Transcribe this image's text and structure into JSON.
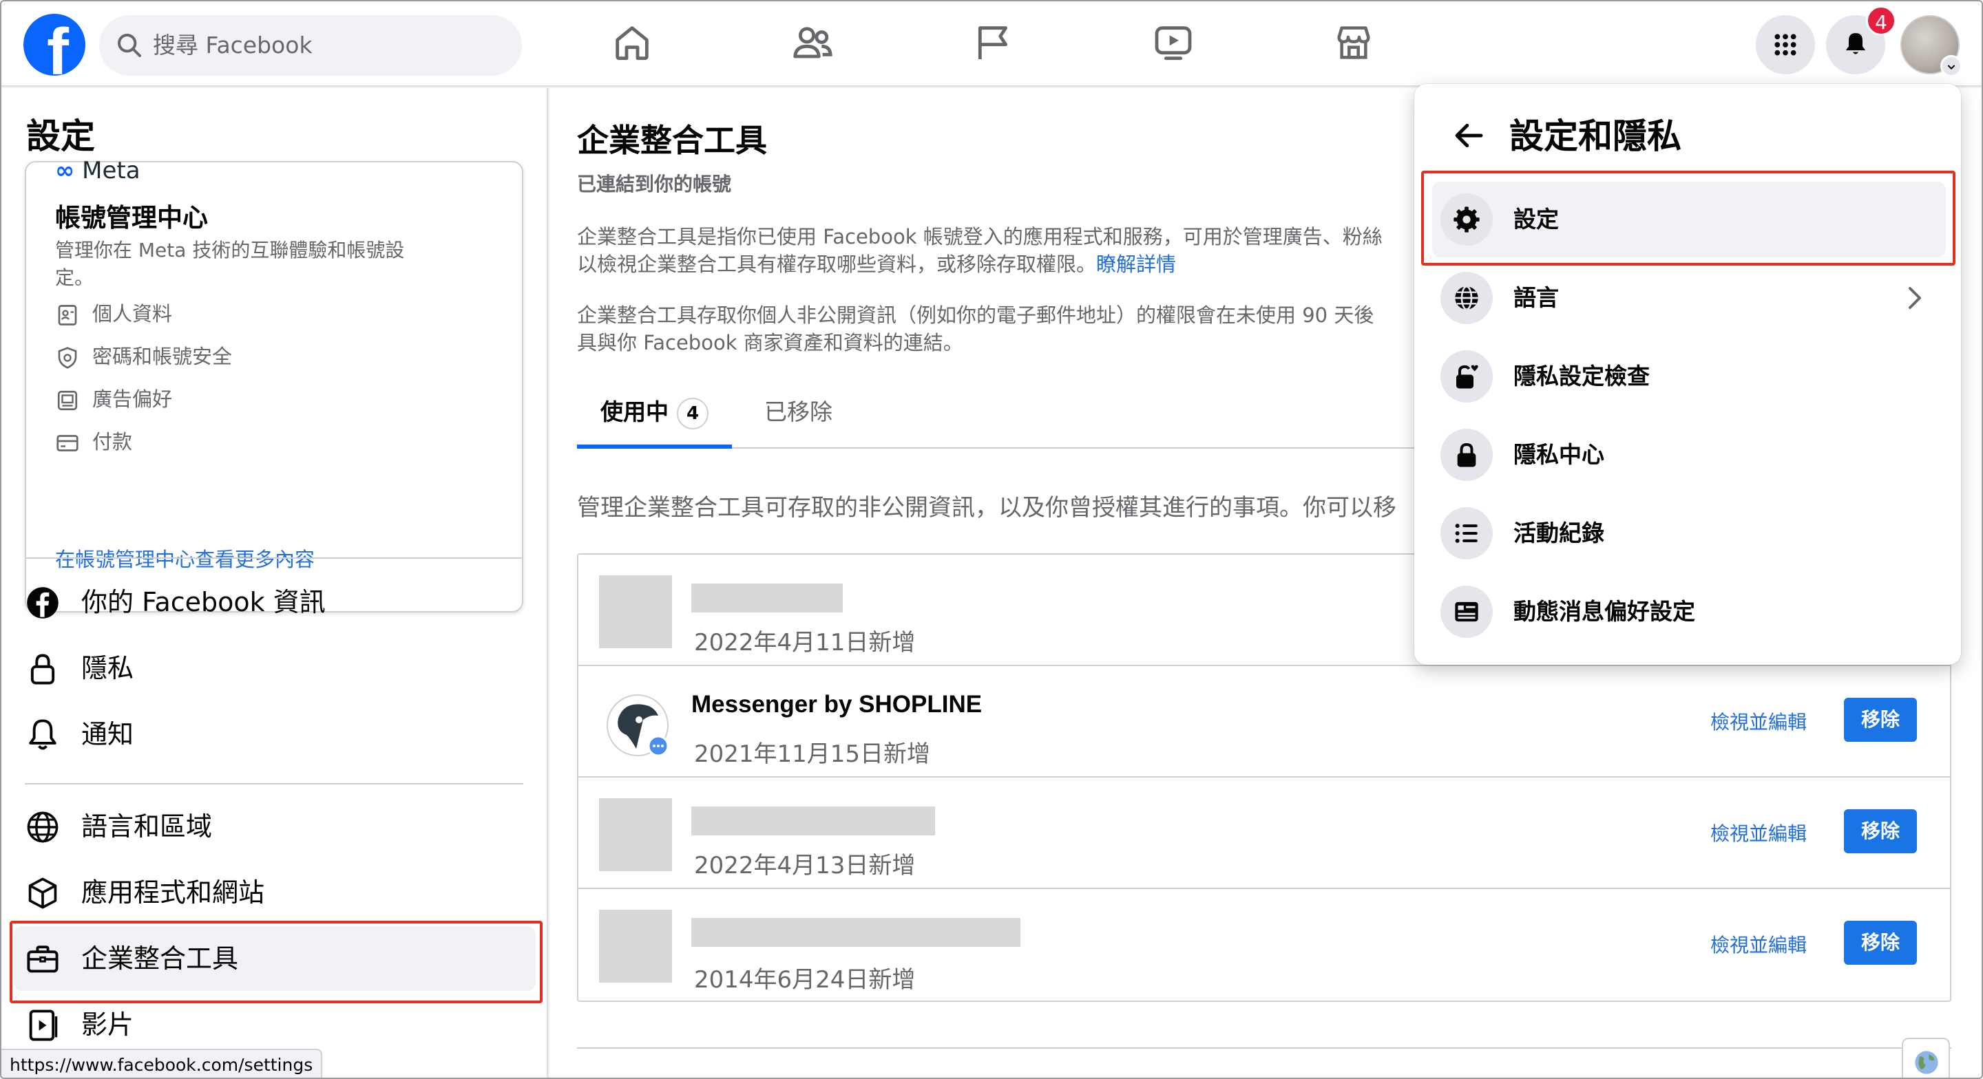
{
  "topbar": {
    "logo_letter": "f",
    "search_placeholder": "搜尋 Facebook",
    "notification_count": "4"
  },
  "sidebar": {
    "title": "設定",
    "account_center": {
      "brand": "Meta",
      "title": "帳號管理中心",
      "description": "管理你在 Meta 技術的互聯體驗和帳號設定。",
      "items": [
        {
          "label": "個人資料",
          "icon": "id-card-icon"
        },
        {
          "label": "密碼和帳號安全",
          "icon": "shield-icon"
        },
        {
          "label": "廣告偏好",
          "icon": "monitor-icon"
        },
        {
          "label": "付款",
          "icon": "credit-card-icon"
        }
      ],
      "more_link": "在帳號管理中心查看更多內容"
    },
    "items": [
      {
        "label": "你的 Facebook 資訊",
        "icon": "facebook-icon"
      },
      {
        "label": "隱私",
        "icon": "lock-icon"
      },
      {
        "label": "通知",
        "icon": "bell-icon"
      },
      {
        "label": "語言和區域",
        "icon": "globe-icon"
      },
      {
        "label": "應用程式和網站",
        "icon": "cube-icon"
      },
      {
        "label": "企業整合工具",
        "icon": "briefcase-icon",
        "active": true
      },
      {
        "label": "影片",
        "icon": "video-icon"
      }
    ],
    "status_url": "https://www.facebook.com/settings"
  },
  "main": {
    "title": "企業整合工具",
    "subtitle": "已連結到你的帳號",
    "para1": "企業整合工具是指你已使用 Facebook 帳號登入的應用程式和服務，可用於管理廣告、粉絲",
    "para1_line2": "以檢視企業整合工具有權存取哪些資料，或移除存取權限。",
    "para1_link": "瞭解詳情",
    "para2": "企業整合工具存取你個人非公開資訊（例如你的電子郵件地址）的權限會在未使用 90 天後",
    "para2_line2": "具與你 Facebook 商家資產和資料的連結。",
    "tabs": [
      {
        "label": "使用中",
        "count": "4"
      },
      {
        "label": "已移除"
      }
    ],
    "manage_text": "管理企業整合工具可存取的非公開資訊，以及你曾授權其進行的事項。你可以移",
    "apps": [
      {
        "name": "",
        "date": "2022年4月11日新增"
      },
      {
        "name": "Messenger by SHOPLINE",
        "date": "2021年11月15日新增",
        "view": "檢視並編輯",
        "remove": "移除"
      },
      {
        "name": "",
        "date": "2022年4月13日新增",
        "view": "檢視並編輯",
        "remove": "移除"
      },
      {
        "name": "",
        "date": "2014年6月24日新增",
        "view": "檢視並編輯",
        "remove": "移除"
      }
    ]
  },
  "dropdown": {
    "title": "設定和隱私",
    "items": [
      {
        "label": "設定",
        "icon": "gear-icon"
      },
      {
        "label": "語言",
        "icon": "globe-icon"
      },
      {
        "label": "隱私設定檢查",
        "icon": "lock-heart-icon"
      },
      {
        "label": "隱私中心",
        "icon": "lock-icon"
      },
      {
        "label": "活動紀錄",
        "icon": "list-icon"
      },
      {
        "label": "動態消息偏好設定",
        "icon": "news-feed-icon"
      }
    ]
  },
  "colors": {
    "brand_blue": "#0866ff",
    "link_blue": "#216fdb",
    "highlight_red": "#e0321e",
    "badge_red": "#e41e3f"
  }
}
